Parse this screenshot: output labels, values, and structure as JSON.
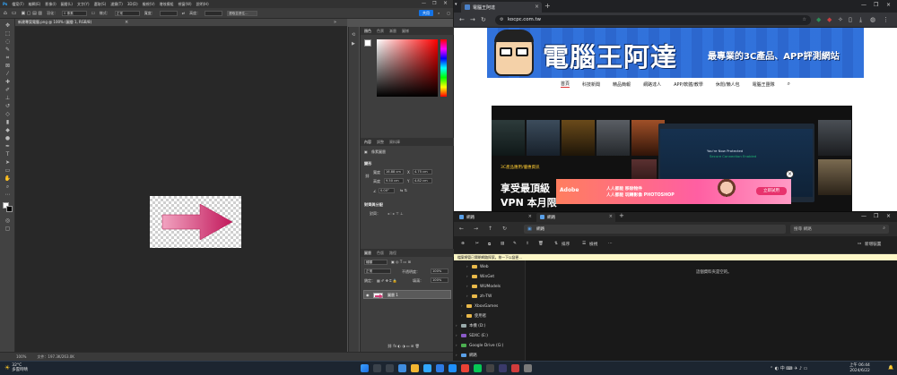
{
  "photoshop": {
    "menu": [
      "檔案(F)",
      "編輯(E)",
      "影像(I)",
      "圖層(L)",
      "文字(Y)",
      "選取(S)",
      "濾鏡(T)",
      "3D(D)",
      "檢視(V)",
      "增效模組",
      "視窗(W)",
      "說明(H)"
    ],
    "options": {
      "feather_label": "羽化：",
      "feather_value": "0 像素",
      "style_label": "樣式：",
      "style_value": "正常",
      "width_label": "寬度：",
      "height_label": "高度：",
      "select_mask_button": "選取並遮住...",
      "share_button": "共用"
    },
    "doc_tab": "新建專案電腦.png @ 100% (圖層 1, RGB/8)",
    "status": {
      "zoom": "100%",
      "doc_size": "文件：197.3K/263.0K"
    },
    "color_panel": {
      "tabs": [
        "顏色",
        "色票",
        "漸層",
        "圖樣"
      ]
    },
    "properties_panel": {
      "tabs": [
        "內容",
        "調整",
        "資料庫"
      ],
      "pixel_layer_label": "像素圖層",
      "transform_title": "變形",
      "w_label": "寬度",
      "w_value": "16.88 cm",
      "x_label": "X",
      "x_value": "4.75 cm",
      "h_label": "高度",
      "h_value": "9.50 cm",
      "y_label": "Y",
      "y_value": "4.82 cm",
      "angle_value": "0.00°",
      "align_title": "對齊與分配",
      "align_label": "對齊："
    },
    "layers_panel": {
      "tabs": [
        "圖層",
        "色版",
        "路徑"
      ],
      "kind_label": "種類",
      "blend_value": "正常",
      "opacity_label": "不透明度：",
      "opacity_value": "100%",
      "lock_label": "鎖定：",
      "fill_label": "填滿：",
      "fill_value": "100%",
      "layer_name": "圖層 1"
    }
  },
  "browser": {
    "tab_title": "電腦王阿達",
    "url": "kocpc.com.tw",
    "site": {
      "logo": "電腦王阿達",
      "slogan": "最專業的3C產品、APP評測網站",
      "nav": [
        "首頁",
        "科技新聞",
        "精品簡報",
        "網路達人",
        "APP/軟體/教學",
        "休閒/懶人包",
        "電腦王團隊"
      ],
      "hero_caption": "3C產品應用/優惠資訊",
      "hero_title_line1": "享受最頂級",
      "hero_title_line2": "VPN 本月限",
      "vpn_line1": "You're Now Protected",
      "vpn_line2": "Secure Connection Enabled"
    },
    "ad": {
      "brand": "Adobe",
      "line1": "人人都能 移除物件",
      "line2": "人人都能 玩轉影像 PHOTOSHOP",
      "cta": "立即試用"
    }
  },
  "explorer": {
    "tabs": [
      "網路",
      "網路"
    ],
    "path": "網路",
    "search_placeholder": "搜尋 網路",
    "commands": [
      "排序",
      "檢視",
      "新增裝置"
    ],
    "warning": "檔案總管已關閉網路探索。按一下以變更...",
    "nav": [
      {
        "label": "Web",
        "indent": 2
      },
      {
        "label": "WinGet",
        "indent": 2
      },
      {
        "label": "WUModels",
        "indent": 2
      },
      {
        "label": "zh-TW",
        "indent": 2
      },
      {
        "label": "XboxGames",
        "indent": 1
      },
      {
        "label": "使用者",
        "indent": 1
      },
      {
        "label": "本機 (D:)",
        "indent": 0
      },
      {
        "label": "SDXC (E:)",
        "indent": 0
      },
      {
        "label": "Google Drive (G:)",
        "indent": 0
      },
      {
        "label": "網路",
        "indent": 0
      }
    ],
    "empty_message": "這個資料夾是空的。"
  },
  "taskbar": {
    "weather_temp": "32°C",
    "weather_desc": "多雲時晴",
    "time": "上午 06:44",
    "date": "2024/6/22"
  }
}
